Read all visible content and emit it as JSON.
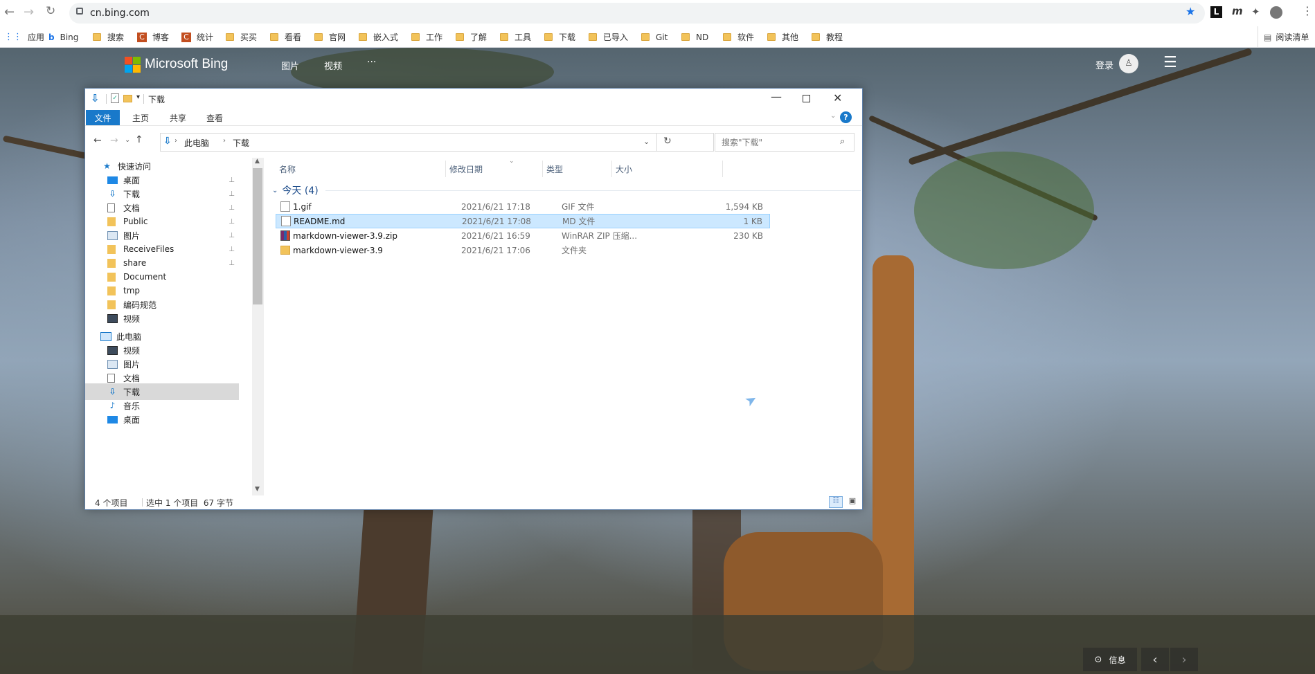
{
  "browser": {
    "url": "cn.bing.com"
  },
  "bookmarks": [
    {
      "label": "应用",
      "icon": "apps-grid-icon"
    },
    {
      "label": "Bing",
      "icon": "bing-icon"
    },
    {
      "label": "搜索",
      "icon": "folder-icon"
    },
    {
      "label": "博客",
      "icon": "c-site-icon"
    },
    {
      "label": "统计",
      "icon": "c-site-icon"
    },
    {
      "label": "买买",
      "icon": "folder-icon"
    },
    {
      "label": "看看",
      "icon": "folder-icon"
    },
    {
      "label": "官网",
      "icon": "folder-icon"
    },
    {
      "label": "嵌入式",
      "icon": "folder-icon"
    },
    {
      "label": "工作",
      "icon": "folder-icon"
    },
    {
      "label": "了解",
      "icon": "folder-icon"
    },
    {
      "label": "工具",
      "icon": "folder-icon"
    },
    {
      "label": "下载",
      "icon": "folder-icon"
    },
    {
      "label": "已导入",
      "icon": "folder-icon"
    },
    {
      "label": "Git",
      "icon": "folder-icon"
    },
    {
      "label": "ND",
      "icon": "folder-icon"
    },
    {
      "label": "软件",
      "icon": "folder-icon"
    },
    {
      "label": "其他",
      "icon": "folder-icon"
    },
    {
      "label": "教程",
      "icon": "folder-icon"
    }
  ],
  "reading_list": "阅读清单",
  "bing": {
    "logo": "Microsoft Bing",
    "nav": [
      "图片",
      "视频",
      "···"
    ],
    "login": "登录",
    "info": "信息"
  },
  "explorer": {
    "title": "下载",
    "ribbon_tabs": [
      "文件",
      "主页",
      "共享",
      "查看"
    ],
    "breadcrumb": [
      "此电脑",
      "下载"
    ],
    "search_placeholder": "搜索\"下载\"",
    "quick_access": "快速访问",
    "quick_items": [
      {
        "label": "桌面",
        "icon": "desktop-icon",
        "pinned": true
      },
      {
        "label": "下载",
        "icon": "download-icon",
        "pinned": true
      },
      {
        "label": "文档",
        "icon": "document-icon",
        "pinned": true
      },
      {
        "label": "Public",
        "icon": "folder-icon",
        "pinned": true
      },
      {
        "label": "图片",
        "icon": "pictures-icon",
        "pinned": true
      },
      {
        "label": "ReceiveFiles",
        "icon": "folder-icon",
        "pinned": true
      },
      {
        "label": "share",
        "icon": "folder-icon",
        "pinned": true
      },
      {
        "label": "Document",
        "icon": "folder-icon",
        "pinned": false
      },
      {
        "label": "tmp",
        "icon": "folder-icon",
        "pinned": false
      },
      {
        "label": "编码规范",
        "icon": "folder-icon",
        "pinned": false
      },
      {
        "label": "视频",
        "icon": "video-icon",
        "pinned": false
      }
    ],
    "this_pc": "此电脑",
    "pc_items": [
      {
        "label": "视频",
        "icon": "video-icon"
      },
      {
        "label": "图片",
        "icon": "pictures-icon"
      },
      {
        "label": "文档",
        "icon": "document-icon"
      },
      {
        "label": "下载",
        "icon": "download-icon",
        "selected": true
      },
      {
        "label": "音乐",
        "icon": "music-icon"
      },
      {
        "label": "桌面",
        "icon": "desktop-icon"
      }
    ],
    "columns": [
      "名称",
      "修改日期",
      "类型",
      "大小"
    ],
    "group": "今天 (4)",
    "files": [
      {
        "name": "1.gif",
        "date": "2021/6/21 17:18",
        "type": "GIF 文件",
        "size": "1,594 KB",
        "icon": "gif-file-icon"
      },
      {
        "name": "README.md",
        "date": "2021/6/21 17:08",
        "type": "MD 文件",
        "size": "1 KB",
        "icon": "md-file-icon",
        "selected": true
      },
      {
        "name": "markdown-viewer-3.9.zip",
        "date": "2021/6/21 16:59",
        "type": "WinRAR ZIP 压缩...",
        "size": "230 KB",
        "icon": "winrar-icon"
      },
      {
        "name": "markdown-viewer-3.9",
        "date": "2021/6/21 17:06",
        "type": "文件夹",
        "size": "",
        "icon": "folder-icon"
      }
    ],
    "status": {
      "count": "4 个项目",
      "selection": "选中 1 个项目  67 字节"
    }
  },
  "colors": {
    "accent": "#1979ca",
    "selection": "#cce8ff",
    "folder": "#f2c35a"
  }
}
